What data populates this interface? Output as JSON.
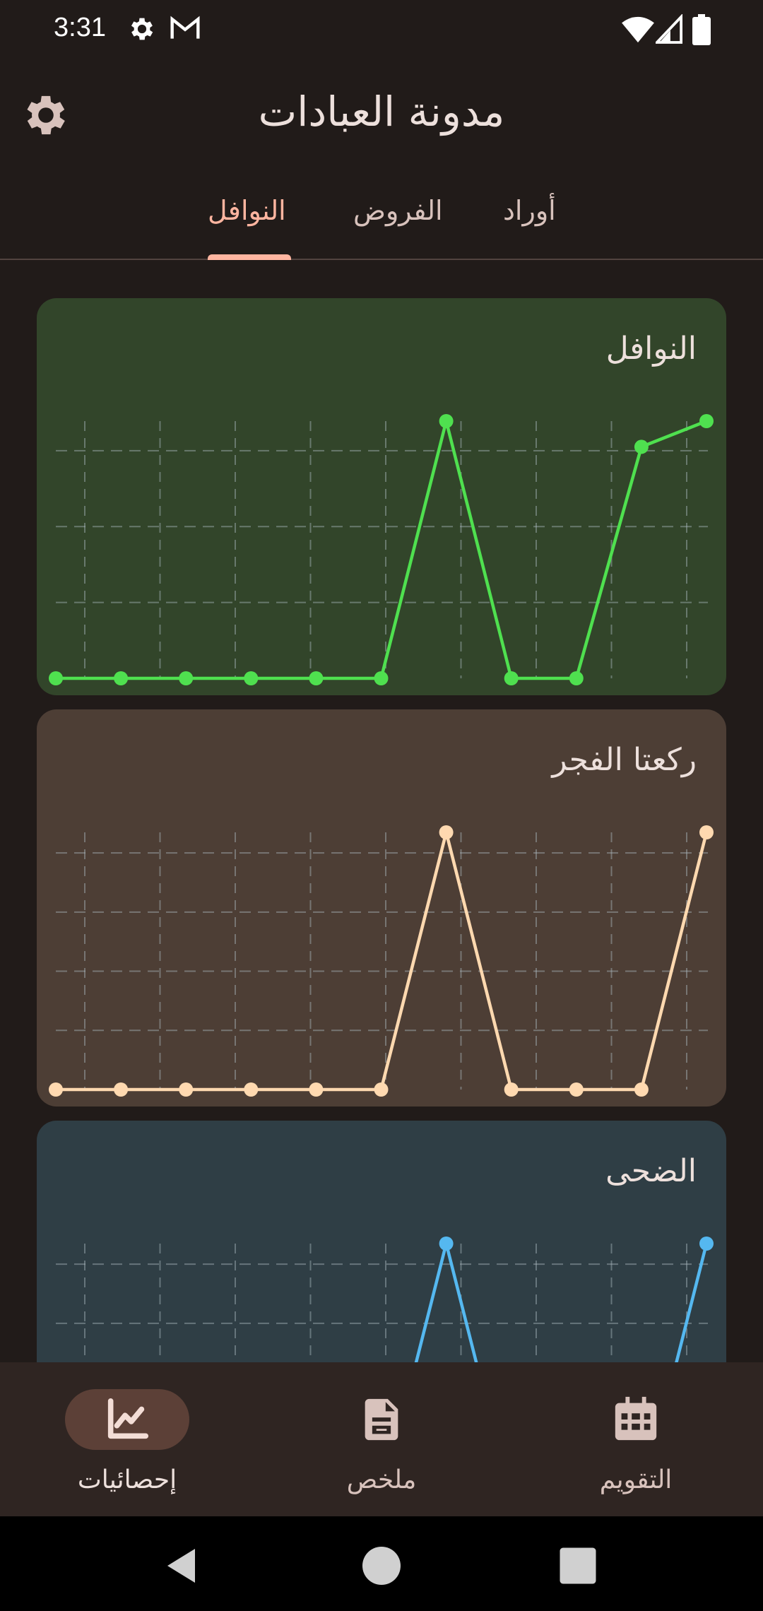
{
  "status_bar": {
    "time": "3:31",
    "icons": [
      "gear-icon",
      "gmail-icon",
      "wifi-icon",
      "signal-icon",
      "battery-icon"
    ]
  },
  "app_bar": {
    "title": "مدونة العبادات",
    "settings_icon": "gear-icon"
  },
  "tabs": [
    {
      "label": "النوافل",
      "active": true
    },
    {
      "label": "الفروض",
      "active": false
    },
    {
      "label": "أوراد",
      "active": false
    }
  ],
  "cards": [
    {
      "title": "النوافل",
      "bg": "#32452a",
      "line_color": "#4fe04f"
    },
    {
      "title": "ركعتا الفجر",
      "bg": "#4d3e35",
      "line_color": "#ffd9b0"
    },
    {
      "title": "الضحى",
      "bg": "#2f3e45",
      "line_color": "#55b8f0"
    }
  ],
  "chart_data": [
    {
      "type": "line",
      "title": "النوافل",
      "x": [
        0,
        1,
        2,
        3,
        4,
        5,
        6,
        7,
        8,
        9,
        10
      ],
      "series": [
        {
          "values": [
            0,
            0,
            0,
            0,
            0,
            0,
            10,
            0,
            0,
            9,
            10
          ]
        }
      ],
      "ylim": [
        0,
        10
      ],
      "grid": true
    },
    {
      "type": "line",
      "title": "ركعتا الفجر",
      "x": [
        0,
        1,
        2,
        3,
        4,
        5,
        6,
        7,
        8,
        9,
        10
      ],
      "series": [
        {
          "values": [
            0,
            0,
            0,
            0,
            0,
            0,
            2,
            0,
            0,
            0,
            2
          ]
        }
      ],
      "ylim": [
        0,
        2
      ],
      "grid": true
    },
    {
      "type": "line",
      "title": "الضحى",
      "x": [
        0,
        1,
        2,
        3,
        4,
        5,
        6,
        7,
        8,
        9,
        10
      ],
      "series": [
        {
          "values": [
            0,
            0,
            0,
            0,
            0,
            0,
            2,
            0,
            0,
            0,
            2
          ]
        }
      ],
      "ylim": [
        0,
        2
      ],
      "grid": true
    }
  ],
  "bottom_nav": [
    {
      "label": "إحصائيات",
      "icon": "chart-icon",
      "active": true
    },
    {
      "label": "ملخص",
      "icon": "document-icon",
      "active": false
    },
    {
      "label": "التقويم",
      "icon": "calendar-icon",
      "active": false
    }
  ],
  "system_nav": [
    "back-icon",
    "home-icon",
    "recents-icon"
  ]
}
